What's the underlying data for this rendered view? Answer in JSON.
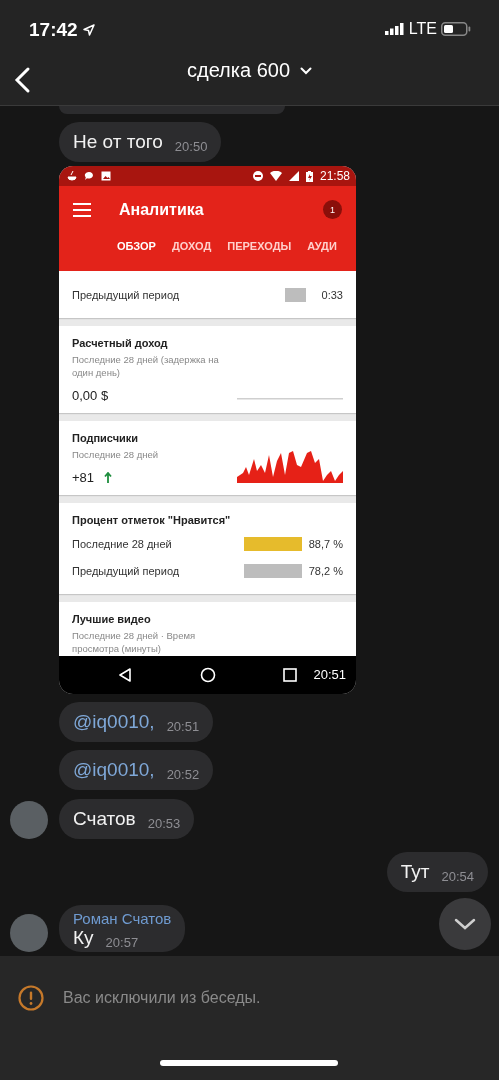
{
  "status_bar": {
    "time": "17:42",
    "network": "LTE"
  },
  "header": {
    "title": "сделка 600"
  },
  "messages": [
    {
      "kind": "cut_off",
      "outgoing": false,
      "avatar": false
    },
    {
      "kind": "text",
      "outgoing": false,
      "avatar": false,
      "text": "Не от того",
      "time": "20:50"
    },
    {
      "kind": "screenshot",
      "outgoing": false,
      "avatar": false,
      "time": "20:51",
      "screenshot": {
        "status_time": "21:58",
        "app_title": "Аналитика",
        "badge": "1",
        "tabs": [
          {
            "label": "ОБЗОР",
            "selected": true
          },
          {
            "label": "ДОХОД",
            "selected": false
          },
          {
            "label": "ПЕРЕХОДЫ",
            "selected": false
          },
          {
            "label": "АУДИ",
            "selected": false
          }
        ],
        "cards": [
          {
            "kind": "rows",
            "rows": [
              {
                "label": "Предыдущий период",
                "value": "0:33",
                "color": "#bdbdbd"
              }
            ]
          },
          {
            "kind": "metric",
            "title": "Расчетный доход",
            "subtitle": "Последние 28 дней (задержка на один день)",
            "value": "0,00 $",
            "trend_up": false
          },
          {
            "kind": "sparkline",
            "title": "Подписчики",
            "subtitle": "Последние 28 дней",
            "value": "+81",
            "trend_up": true
          },
          {
            "kind": "compare",
            "title": "Процент отметок \"Нравится\"",
            "rows": [
              {
                "label": "Последние 28 дней",
                "value": "88,7 %",
                "color": "#e6bb2c"
              },
              {
                "label": "Предыдущий период",
                "value": "78,2 %",
                "color": "#bdbdbd"
              }
            ]
          },
          {
            "kind": "heading",
            "title": "Лучшие видео",
            "subtitle": "Последние 28 дней · Время просмотра (минуты)"
          }
        ]
      }
    },
    {
      "kind": "text",
      "outgoing": false,
      "avatar": false,
      "mention": true,
      "text": "@iq0010,",
      "time": "20:51"
    },
    {
      "kind": "text",
      "outgoing": false,
      "avatar": false,
      "mention": true,
      "text": "@iq0010,",
      "time": "20:52"
    },
    {
      "kind": "text",
      "outgoing": false,
      "avatar": true,
      "text": "Счатов",
      "time": "20:53"
    },
    {
      "kind": "text",
      "outgoing": true,
      "text": "Тут",
      "time": "20:54"
    },
    {
      "kind": "text",
      "outgoing": false,
      "avatar": true,
      "sender": "Роман Счатов",
      "text": "Ку",
      "time": "20:57"
    }
  ],
  "notice": {
    "text": "Вас исключили из беседы."
  }
}
